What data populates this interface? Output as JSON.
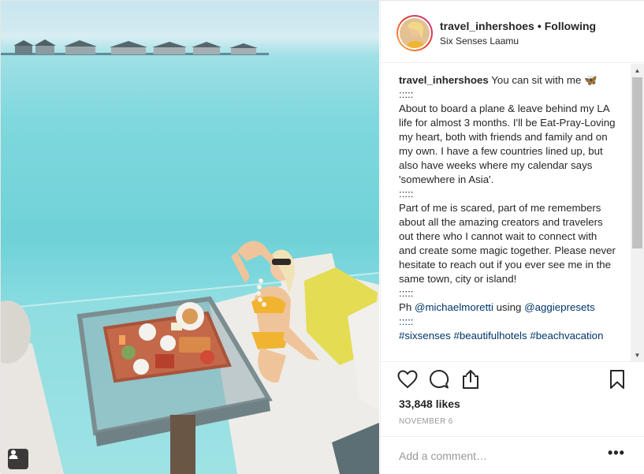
{
  "post": {
    "username": "travel_inhershoes",
    "separator": "•",
    "follow_status": "Following",
    "location": "Six Senses Laamu"
  },
  "caption": {
    "username": "travel_inhershoes",
    "lead": " You can sit with me ",
    "emoji": "🦋",
    "body": "\n:::::\nAbout to board a plane & leave behind my LA life for almost 3 months. I'll be Eat-Pray-Loving my heart, both with friends and family and on my own. I have a few countries lined up, but also have weeks where my calendar says 'somewhere in Asia'.\n:::::\nPart of me is scared, part of me remembers about all the amazing creators and travelers out there who I cannot wait to connect with and create some magic together. Please never hesitate to reach out if you ever see me in the same town, city or island!\n:::::\nPh ",
    "mention1": "@michaelmoretti",
    "mid": " using ",
    "mention2": "@aggiepresets",
    "tail": "\n:::::\n#sixsenses #beautifulhotels #beachvacation"
  },
  "stats": {
    "likes": "33,848 likes",
    "date": "NOVEMBER 6"
  },
  "comment": {
    "placeholder": "Add a comment…",
    "more": "•••"
  },
  "icons": {
    "like": "heart-icon",
    "comment": "comment-bubble-icon",
    "share": "share-icon",
    "save": "bookmark-icon",
    "tagged": "person-tag-icon"
  },
  "colors": {
    "mention": "#003569",
    "text": "#262626",
    "muted": "#999999",
    "story_ring_start": "#f9c04a",
    "story_ring_end": "#c43593"
  }
}
